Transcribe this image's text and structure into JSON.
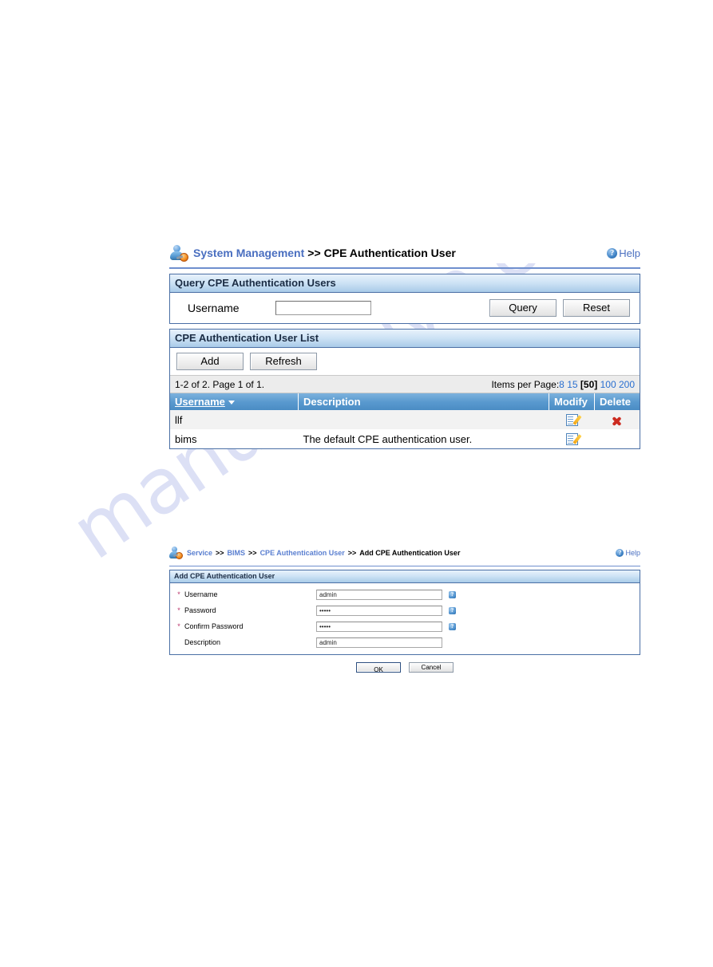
{
  "watermark": {
    "text": "manualshive.com"
  },
  "section_one": {
    "breadcrumb": {
      "icon": "user-admin-icon",
      "link": "System Management",
      "separator": ">>",
      "current": "CPE Authentication User"
    },
    "help": {
      "icon": "help-icon",
      "label": "Help"
    },
    "query_panel": {
      "title": "Query CPE Authentication Users",
      "username_label": "Username",
      "username_value": "",
      "username_placeholder": "",
      "query_button": "Query",
      "reset_button": "Reset"
    },
    "list_panel": {
      "title": "CPE Authentication User List",
      "add_button": "Add",
      "refresh_button": "Refresh",
      "pager_info": "1-2 of 2. Page 1 of 1.",
      "items_per_page_label": "Items per Page:",
      "items_per_page_options": [
        "8",
        "15",
        "50",
        "100",
        "200"
      ],
      "items_per_page_selected": "50",
      "columns": [
        "Username",
        "Description",
        "Modify",
        "Delete"
      ],
      "rows": [
        {
          "username": "llf",
          "description": "",
          "modify_icon": "edit-pencil-icon",
          "delete_icon": "delete-x-icon",
          "has_delete": true
        },
        {
          "username": "bims",
          "description": "The default CPE authentication user.",
          "modify_icon": "edit-pencil-icon",
          "delete_icon": "",
          "has_delete": false
        }
      ]
    }
  },
  "section_two": {
    "breadcrumb": {
      "icon": "user-admin-icon",
      "link1": "Service",
      "sep1": ">>",
      "link2": "BIMS",
      "sep2": ">>",
      "link3": "CPE Authentication User",
      "sep3": ">>",
      "current": "Add CPE Authentication User"
    },
    "help": {
      "icon": "help-icon",
      "label": "Help"
    },
    "form_panel": {
      "title": "Add CPE Authentication User",
      "fields": [
        {
          "label": "Username",
          "value": "admin",
          "required": true,
          "tip": "?"
        },
        {
          "label": "Password",
          "value": "•••••",
          "required": true,
          "tip": "?"
        },
        {
          "label": "Confirm Password",
          "value": "•••••",
          "required": true,
          "tip": "?"
        },
        {
          "label": "Description",
          "value": "admin",
          "required": false,
          "tip": ""
        }
      ],
      "ok_button": "OK",
      "cancel_button": "Cancel"
    }
  },
  "colors": {
    "panel_border": "#4a6fa5",
    "panel_header_blue": "#a9cbe8",
    "table_header_blue": "#5a9acf",
    "link_blue": "#2a6fd0",
    "crumb_blue": "#4a6fc0",
    "delete_red": "#cc2b20",
    "pencil_yellow": "#f2a416",
    "watermark": "#96a0e1"
  }
}
